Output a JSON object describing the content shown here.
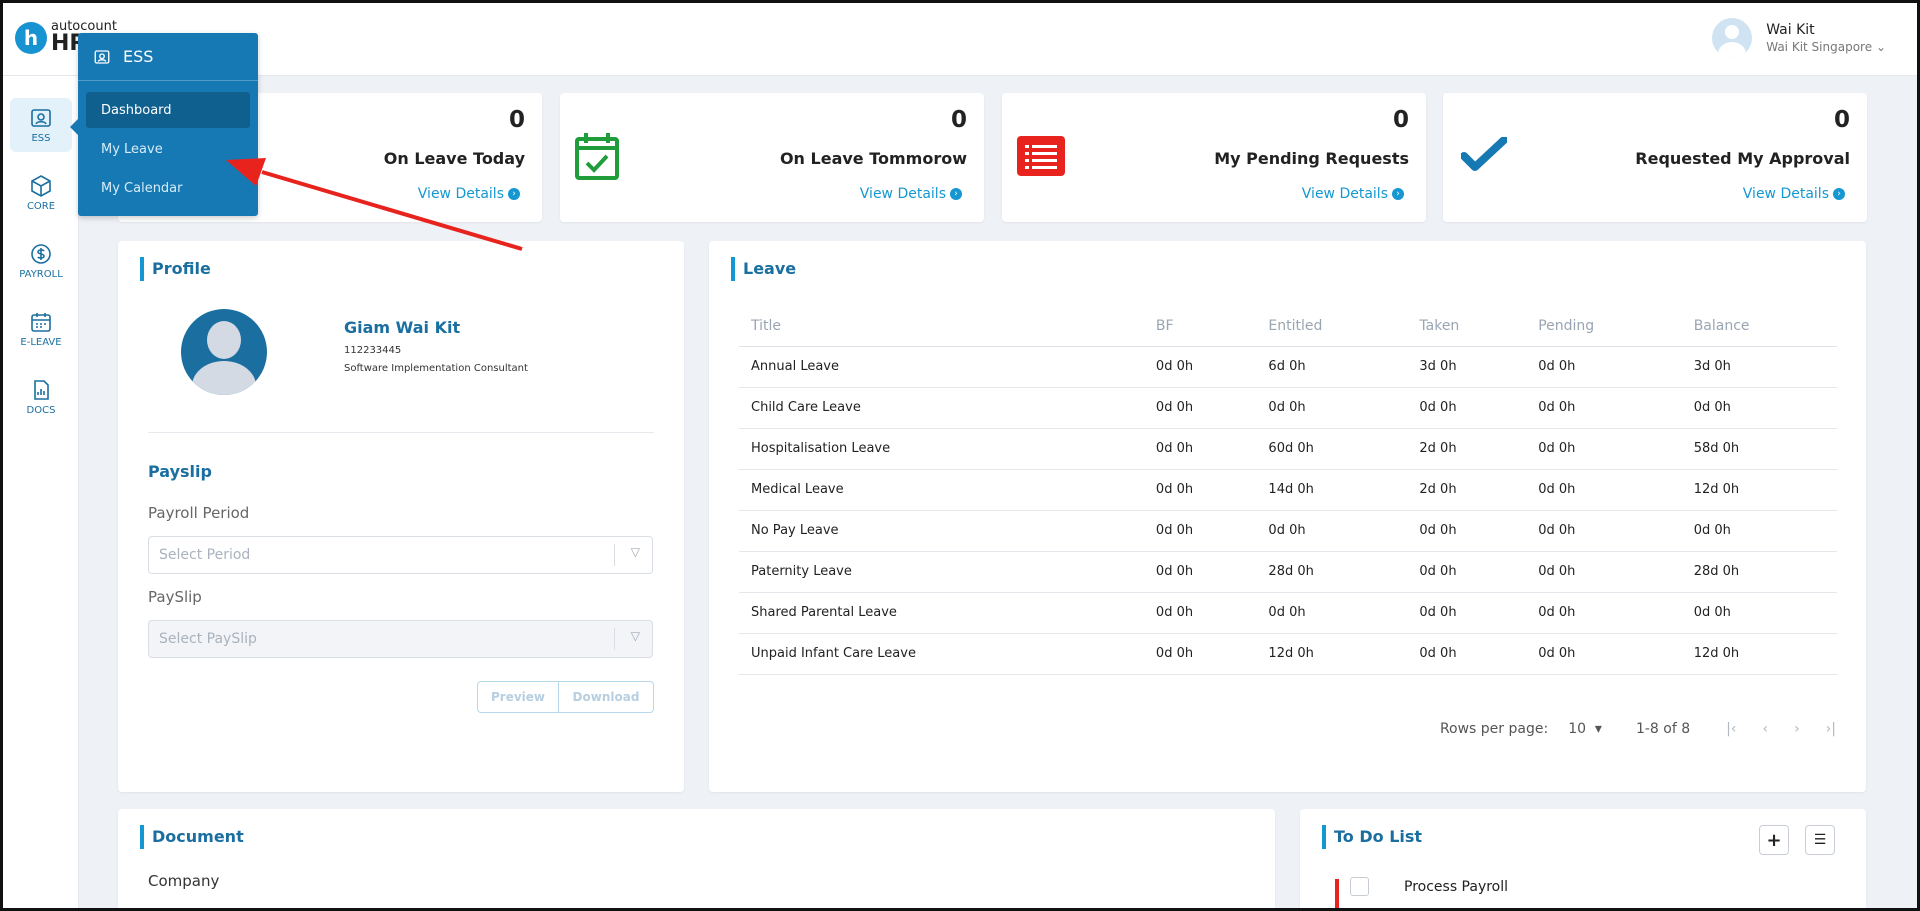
{
  "brand": {
    "logo_letter": "h",
    "logo_small": "autocount",
    "logo_big": "HR"
  },
  "user": {
    "name": "Wai Kit",
    "company": "Wai Kit Singapore"
  },
  "rail": [
    {
      "label": "ESS",
      "icon": "ess-icon"
    },
    {
      "label": "CORE",
      "icon": "cube-icon"
    },
    {
      "label": "PAYROLL",
      "icon": "dollar-icon"
    },
    {
      "label": "E-LEAVE",
      "icon": "calendar-icon"
    },
    {
      "label": "DOCS",
      "icon": "document-icon"
    }
  ],
  "flyout": {
    "title": "ESS",
    "items": [
      "Dashboard",
      "My Leave",
      "My Calendar"
    ]
  },
  "stats": [
    {
      "value": "0",
      "title": "On Leave Today",
      "link": "View Details",
      "icon": "none"
    },
    {
      "value": "0",
      "title": "On Leave Tommorow",
      "link": "View Details",
      "icon": "calendar-check-icon",
      "color": "#1f9d3a"
    },
    {
      "value": "0",
      "title": "My Pending Requests",
      "link": "View Details",
      "icon": "list-icon",
      "color": "#e8231d"
    },
    {
      "value": "0",
      "title": "Requested My Approval",
      "link": "View Details",
      "icon": "checkmark-icon",
      "color": "#1679b3"
    }
  ],
  "profile": {
    "title": "Profile",
    "name": "Giam Wai Kit",
    "id": "112233445",
    "role": "Software Implementation Consultant",
    "payslip_title": "Payslip",
    "payroll_period_label": "Payroll Period",
    "payroll_period_placeholder": "Select Period",
    "payslip_label": "PaySlip",
    "payslip_placeholder": "Select PaySlip",
    "preview": "Preview",
    "download": "Download"
  },
  "leave": {
    "title": "Leave",
    "columns": [
      "Title",
      "BF",
      "Entitled",
      "Taken",
      "Pending",
      "Balance"
    ],
    "rows": [
      [
        "Annual Leave",
        "0d 0h",
        "6d 0h",
        "3d 0h",
        "0d 0h",
        "3d 0h"
      ],
      [
        "Child Care Leave",
        "0d 0h",
        "0d 0h",
        "0d 0h",
        "0d 0h",
        "0d 0h"
      ],
      [
        "Hospitalisation Leave",
        "0d 0h",
        "60d 0h",
        "2d 0h",
        "0d 0h",
        "58d 0h"
      ],
      [
        "Medical Leave",
        "0d 0h",
        "14d 0h",
        "2d 0h",
        "0d 0h",
        "12d 0h"
      ],
      [
        "No Pay Leave",
        "0d 0h",
        "0d 0h",
        "0d 0h",
        "0d 0h",
        "0d 0h"
      ],
      [
        "Paternity Leave",
        "0d 0h",
        "28d 0h",
        "0d 0h",
        "0d 0h",
        "28d 0h"
      ],
      [
        "Shared Parental Leave",
        "0d 0h",
        "0d 0h",
        "0d 0h",
        "0d 0h",
        "0d 0h"
      ],
      [
        "Unpaid Infant Care Leave",
        "0d 0h",
        "12d 0h",
        "0d 0h",
        "0d 0h",
        "12d 0h"
      ]
    ],
    "rows_per_page_label": "Rows per page:",
    "rows_per_page": "10",
    "range": "1-8 of 8"
  },
  "document": {
    "title": "Document",
    "company_label": "Company"
  },
  "todo": {
    "title": "To Do List",
    "item": "Process Payroll"
  },
  "annotation": {
    "arrow_color": "#e8231d"
  }
}
